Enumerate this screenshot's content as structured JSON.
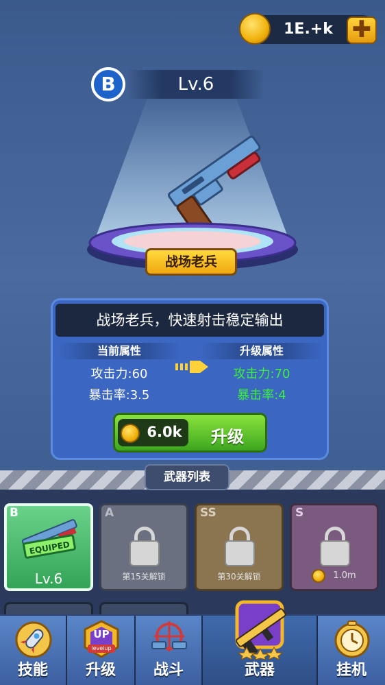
{
  "currency": {
    "amount": "1E.+k",
    "plus_label": "✚"
  },
  "weapon": {
    "grade": "B",
    "level": "Lv.6",
    "name": "战场老兵",
    "description": "战场老兵，快速射击稳定输出"
  },
  "attributes": {
    "current_header": "当前属性",
    "upgrade_header": "升级属性",
    "current": [
      {
        "text": "攻击力:60"
      },
      {
        "text": "暴击率:3.5"
      }
    ],
    "upgrade": [
      {
        "text": "攻击力:70"
      },
      {
        "text": "暴击率:4"
      }
    ]
  },
  "upgrade_button": {
    "cost": "6.0k",
    "label": "升级"
  },
  "weapon_list": {
    "title": "武器列表",
    "cards": [
      {
        "grade": "B",
        "footer": "Lv.6",
        "badge": "EQUIPED",
        "locked": false
      },
      {
        "grade": "A",
        "footer": "第15关解锁",
        "locked": true
      },
      {
        "grade": "SS",
        "footer": "第30关解锁",
        "locked": true
      },
      {
        "grade": "S",
        "footer": "1.0m",
        "locked": true
      }
    ]
  },
  "nav": [
    {
      "label": "技能"
    },
    {
      "label": "升级",
      "icon_text": "UP",
      "icon_sub": "levelup"
    },
    {
      "label": "战斗"
    },
    {
      "label": "武器",
      "active": true
    },
    {
      "label": "挂机"
    }
  ],
  "colors": {
    "upgrade_green": "#3cf03c",
    "gold": "#f0b10c",
    "panel_blue": "#3b66c1"
  }
}
